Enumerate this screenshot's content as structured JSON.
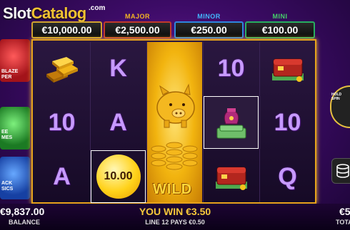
{
  "branding": {
    "logo_part1": "Slot",
    "logo_part2": "Catalog",
    "logo_suffix": ".com"
  },
  "jackpots": {
    "grand": {
      "label": "",
      "value": "€10,000.00"
    },
    "major": {
      "label": "MAJOR",
      "value": "€2,500.00"
    },
    "minor": {
      "label": "MINOR",
      "value": "€250.00"
    },
    "mini": {
      "label": "MINI",
      "value": "€100.00"
    }
  },
  "reels": [
    [
      "gold-bars",
      "K",
      "10",
      "A"
    ],
    [
      "K",
      "A",
      "10.00"
    ],
    [
      "pig-wild"
    ],
    [
      "10",
      "money-bag",
      "wallet"
    ],
    [
      "wallet",
      "10",
      "Q"
    ]
  ],
  "symbols": {
    "r1c1": "gold-bars-icon",
    "r2c1": "10",
    "r3c1": "A",
    "r1c2": "K",
    "r2c2": "A",
    "r3c2": "10.00",
    "wild_label": "WILD",
    "r1c4": "10",
    "r2c4": "money-bag-icon",
    "r3c4": "wallet-icon",
    "r1c5": "wallet-icon",
    "r2c5": "10",
    "r3c5": "Q"
  },
  "side_panels": {
    "left_1_text": "BLAZE\nPER",
    "left_2_text": "EE\nMES",
    "left_3_text": "ACK\nSICS",
    "right_round_label": "HOLD SPIN"
  },
  "footer": {
    "balance_value": "€9,837.00",
    "balance_label": "BALANCE",
    "win_text": "YOU WIN €3.50",
    "line_text": "LINE 12 PAYS €0.50",
    "right_value": "€5",
    "right_label": "TOTA"
  },
  "colors": {
    "gold": "#e6a21b",
    "major": "#f5b623",
    "minor": "#42b8ff",
    "mini": "#45d06a",
    "background": "#3c0b66"
  }
}
